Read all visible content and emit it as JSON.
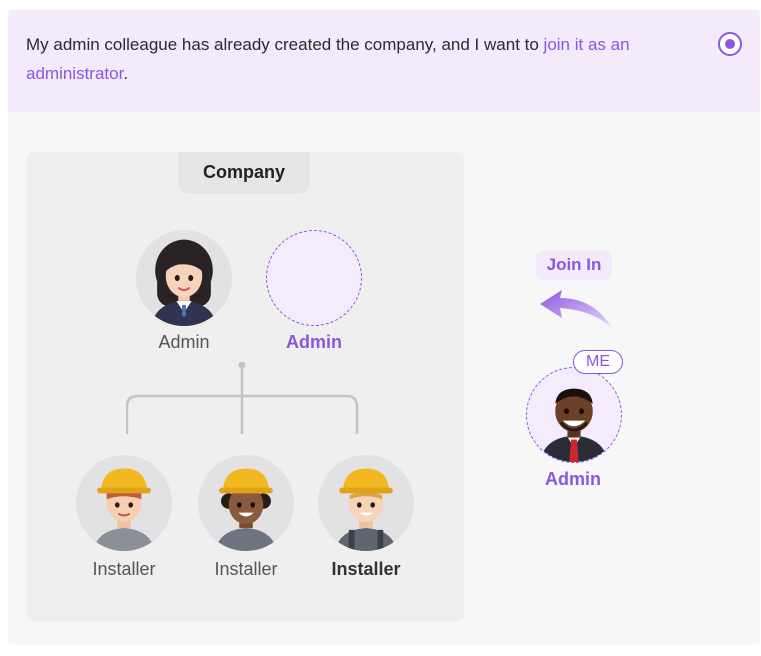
{
  "banner": {
    "text_before": "My admin colleague has already created the company, and I want to ",
    "link_text": "join it as an administrator",
    "text_after": ".",
    "selected": true
  },
  "company": {
    "title": "Company",
    "admins": [
      {
        "label": "Admin"
      },
      {
        "label": "Admin"
      }
    ],
    "installers": [
      {
        "label": "Installer"
      },
      {
        "label": "Installer"
      },
      {
        "label": "Installer"
      }
    ]
  },
  "join": {
    "label": "Join In",
    "badge": "ME",
    "role": "Admin"
  },
  "colors": {
    "accent": "#8b57e0",
    "banner_bg": "#f3eafc",
    "panel_bg": "#efefef"
  }
}
